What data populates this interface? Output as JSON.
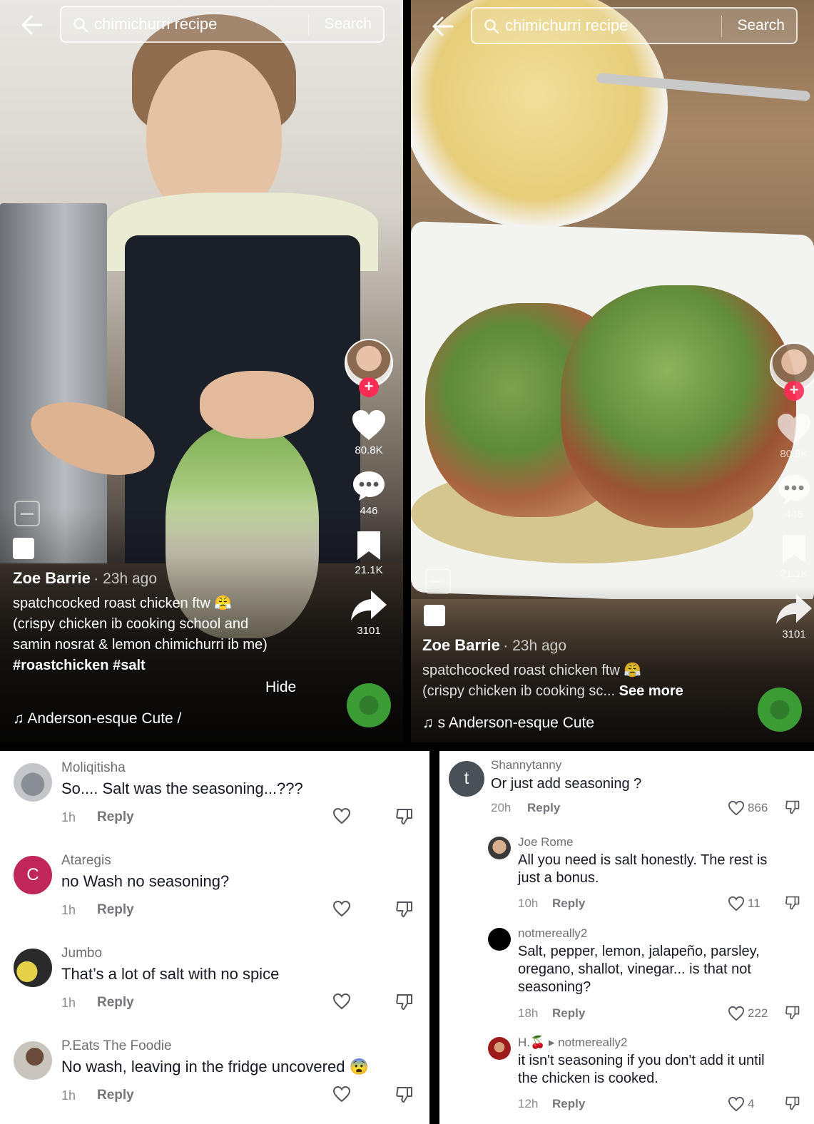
{
  "search": {
    "query": "chimichurri recipe",
    "button": "Search"
  },
  "left_video": {
    "author": "Zoe Barrie",
    "time": "· 23h ago",
    "caption_lines": [
      "spatchcocked roast chicken ftw 😤",
      "(crispy chicken ib cooking school and",
      "samin nosrat & lemon chimichurri ib me)"
    ],
    "hashtags": "#roastchicken #salt",
    "hide_label": "Hide",
    "music": "♫ Anderson-esque Cute /",
    "likes": "80.8K",
    "comments": "446",
    "saves": "21.1K",
    "shares": "3101",
    "follow": "+"
  },
  "right_video": {
    "author": "Zoe Barrie",
    "time": "· 23h ago",
    "caption_lines": [
      "spatchcocked roast chicken ftw 😤",
      "(crispy chicken ib cooking sc..."
    ],
    "see_more": "See more",
    "music": "♫ s Anderson-esque Cute",
    "likes": "80.8K",
    "comments": "446",
    "saves": "21.1K",
    "shares": "3101",
    "follow": "+"
  },
  "comments_left": [
    {
      "user": "Moliqitisha",
      "text": "So.... Salt was the seasoning...???",
      "time": "1h",
      "reply": "Reply"
    },
    {
      "user": "Ataregis",
      "initial": "C",
      "text": "no Wash no seasoning?",
      "time": "1h",
      "reply": "Reply"
    },
    {
      "user": "Jumbo",
      "text": "That’s a lot of salt with no spice",
      "time": "1h",
      "reply": "Reply"
    },
    {
      "user": "P.Eats The Foodie",
      "text": "No wash, leaving in the fridge uncovered 😨",
      "time": "1h",
      "reply": "Reply"
    }
  ],
  "comments_right": {
    "main": {
      "user": "Shannytanny",
      "initial": "t",
      "text": "Or just add seasoning ?",
      "time": "20h",
      "reply": "Reply",
      "likes": "866"
    },
    "replies": [
      {
        "user": "Joe Rome",
        "text_lines": [
          "All you need is salt honestly. The rest is",
          "just a bonus."
        ],
        "time": "10h",
        "reply": "Reply",
        "likes": "11"
      },
      {
        "user": "notmereally2",
        "text_lines": [
          "Salt, pepper, lemon, jalapeño, parsley,",
          "oregano, shallot, vinegar... is that not",
          "seasoning?"
        ],
        "time": "18h",
        "reply": "Reply",
        "likes": "222"
      },
      {
        "user": "H.🍒",
        "reply_to": "▸ notmereally2",
        "text_lines": [
          "it isn't seasoning if you don't add it until",
          "the chicken is cooked."
        ],
        "time": "12h",
        "reply": "Reply",
        "likes": "4"
      }
    ]
  },
  "colors": {
    "follow": "#fe2c55",
    "ataregis_avatar": "#c0265a",
    "shanny_avatar": "#4a5058"
  }
}
